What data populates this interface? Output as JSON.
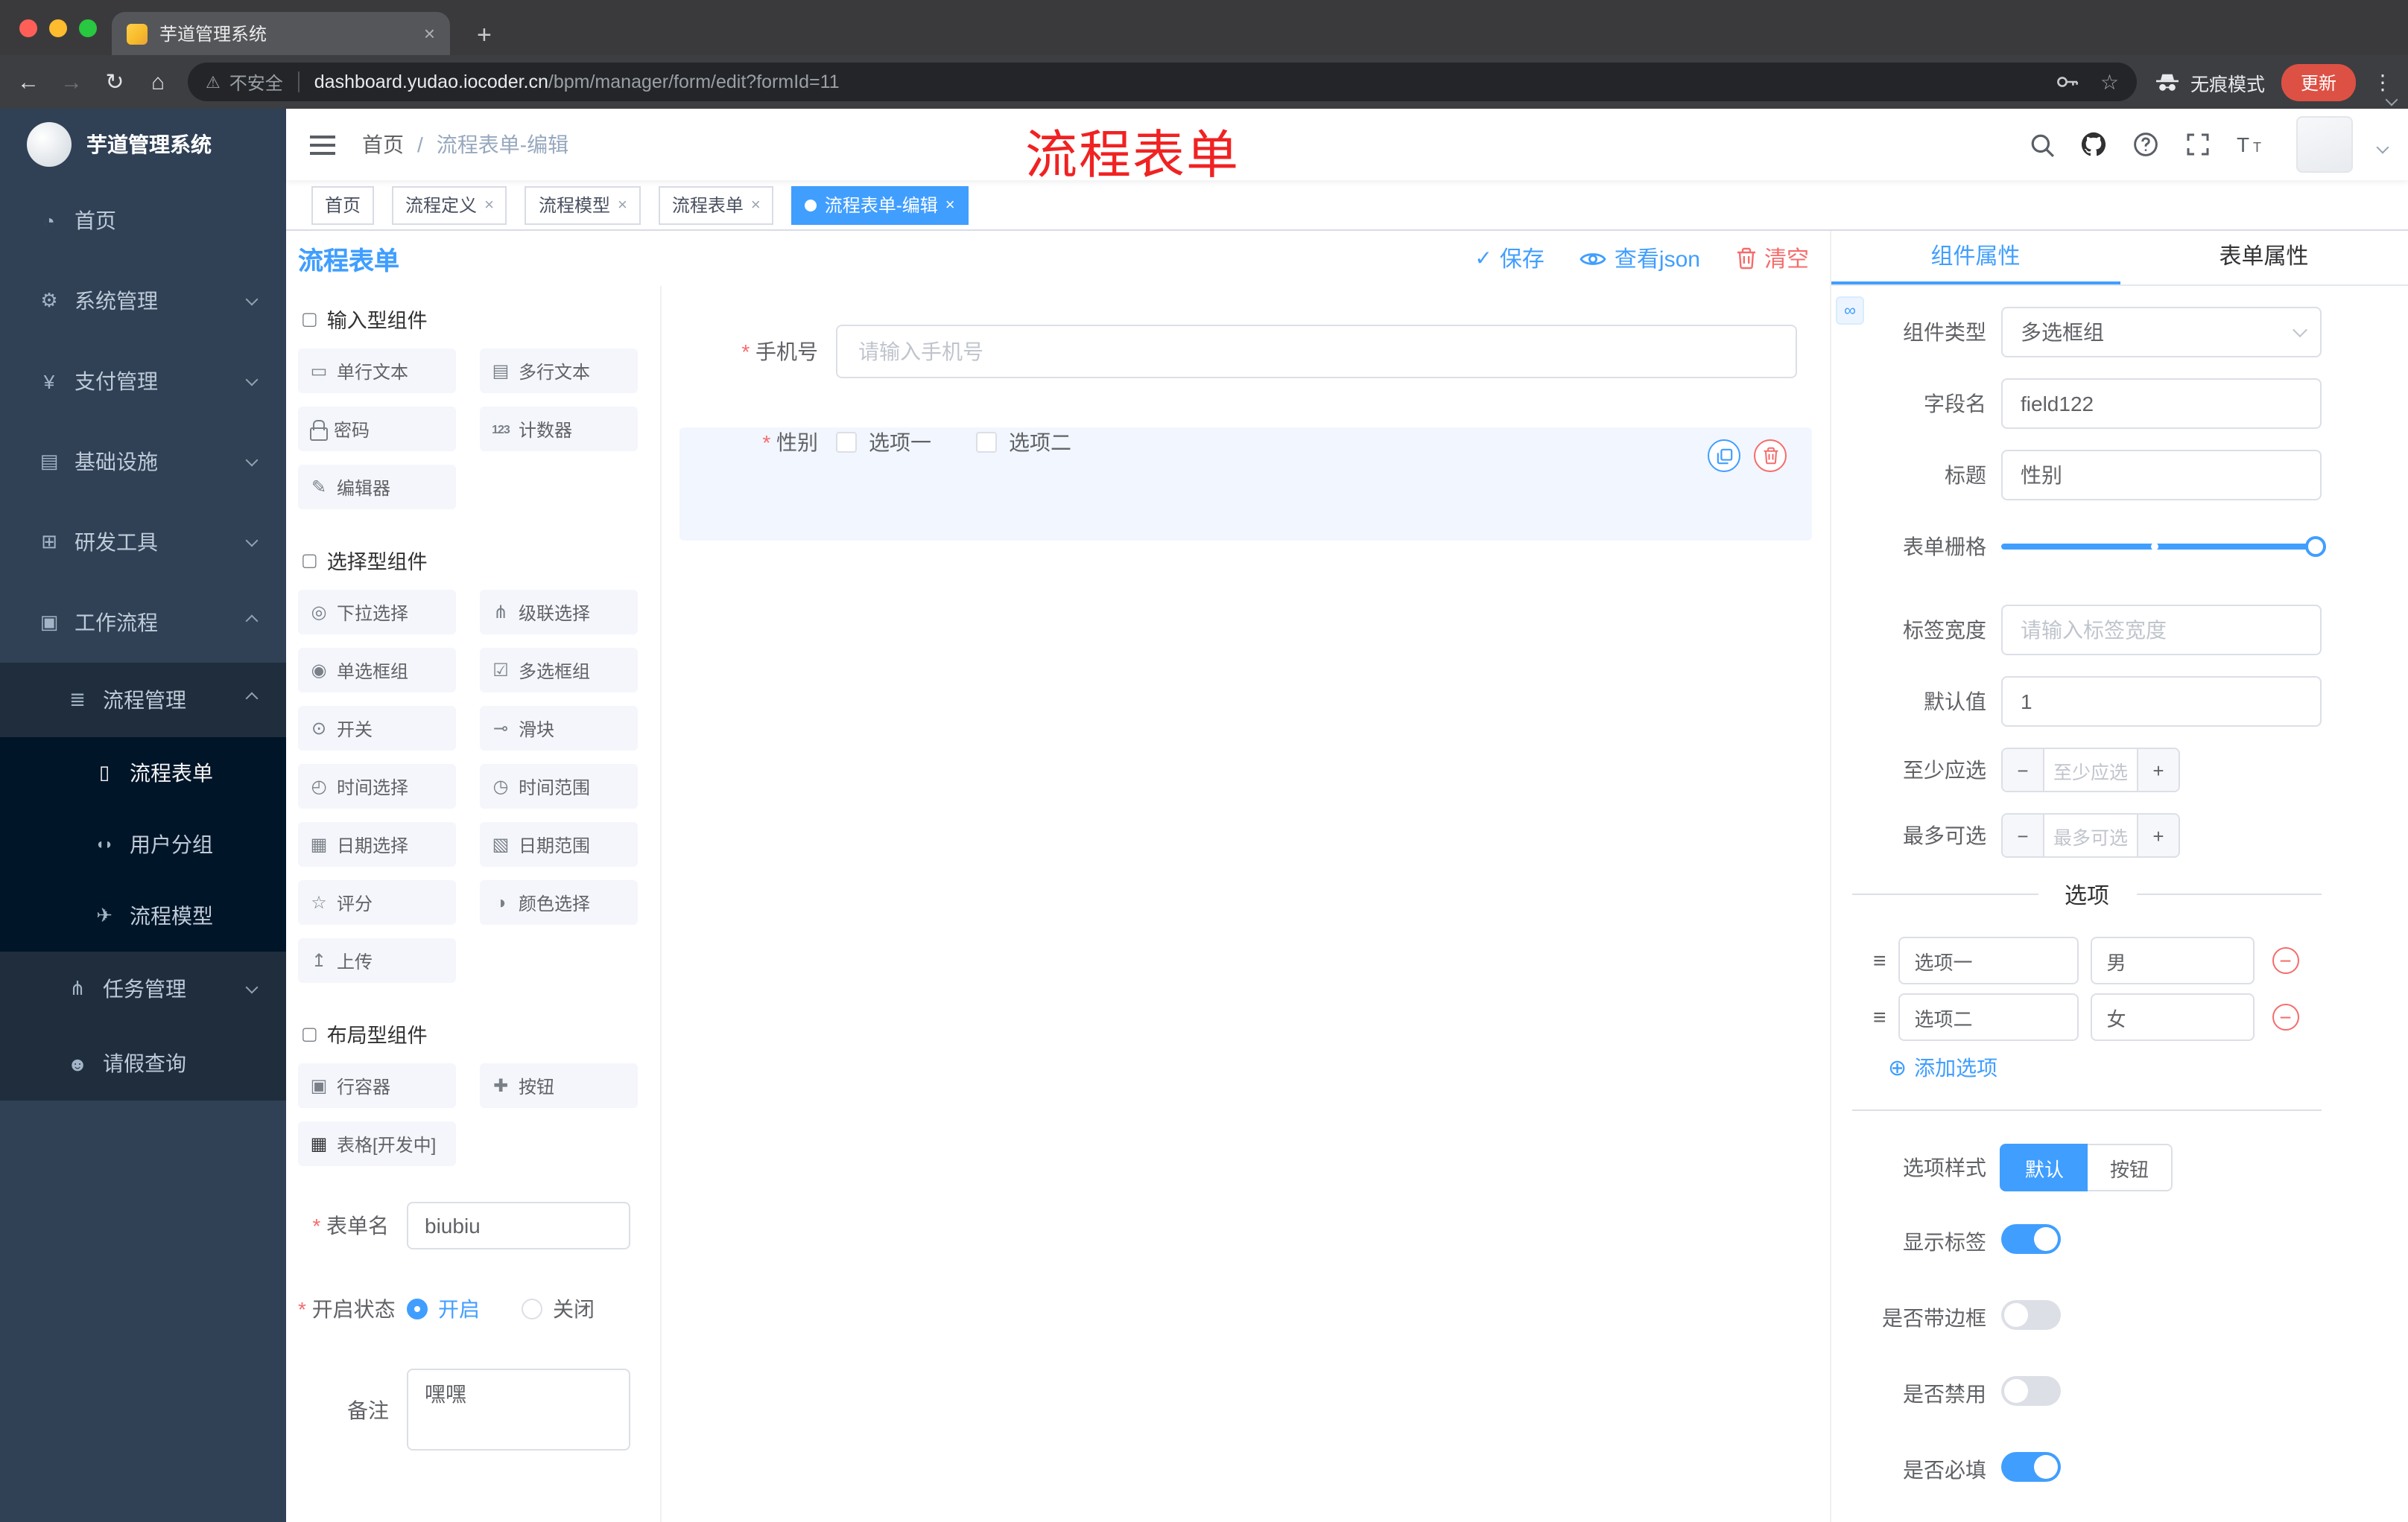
{
  "colors": {
    "primary": "#409eff",
    "danger": "#f56c6c",
    "annotation_red": "#f02222",
    "sidebar_bg": "#304156",
    "submenu_bg": "#1f2d3d",
    "submenu_deep_bg": "#001528",
    "active_tag_bg": "#409eff",
    "update_button_bg": "#dd5144"
  },
  "browser": {
    "tab_title": "芋道管理系统",
    "security_label": "不安全",
    "url_host": "dashboard.yudao.iocoder.cn",
    "url_path": "/bpm/manager/form/edit?formId=11",
    "incognito_label": "无痕模式",
    "update_label": "更新"
  },
  "sidebar": {
    "logo_title": "芋道管理系统",
    "items": [
      {
        "icon": "dashboard-icon",
        "label": "首页"
      },
      {
        "icon": "gear-icon",
        "label": "系统管理"
      },
      {
        "icon": "yen-icon",
        "label": "支付管理"
      },
      {
        "icon": "infrastructure-icon",
        "label": "基础设施"
      },
      {
        "icon": "dev-tools-icon",
        "label": "研发工具"
      },
      {
        "icon": "workflow-icon",
        "label": "工作流程"
      },
      {
        "icon": "process-management-icon",
        "label": "流程管理"
      },
      {
        "icon": "process-form-icon",
        "label": "流程表单"
      },
      {
        "icon": "user-group-icon",
        "label": "用户分组"
      },
      {
        "icon": "process-model-icon",
        "label": "流程模型"
      },
      {
        "icon": "task-management-icon",
        "label": "任务管理"
      },
      {
        "icon": "leave-query-icon",
        "label": "请假查询"
      }
    ]
  },
  "navbar": {
    "breadcrumb": {
      "home": "首页",
      "separator": "/",
      "current": "流程表单-编辑"
    },
    "annotation": "流程表单"
  },
  "tags": [
    {
      "label": "首页",
      "closable": false,
      "active": false
    },
    {
      "label": "流程定义",
      "closable": true,
      "active": false
    },
    {
      "label": "流程模型",
      "closable": true,
      "active": false
    },
    {
      "label": "流程表单",
      "closable": true,
      "active": false
    },
    {
      "label": "流程表单-编辑",
      "closable": true,
      "active": true
    }
  ],
  "designer": {
    "title": "流程表单",
    "save": "保存",
    "view_json": "查看json",
    "clear": "清空"
  },
  "palette": {
    "sections": [
      {
        "title": "输入型组件",
        "items": [
          {
            "icon": "text-field-icon",
            "label": "单行文本"
          },
          {
            "icon": "textarea-icon",
            "label": "多行文本"
          },
          {
            "icon": "lock-icon",
            "label": "密码"
          },
          {
            "icon": "counter-icon",
            "icon_text": "123",
            "label": "计数器"
          },
          {
            "icon": "editor-icon",
            "label": "编辑器"
          }
        ]
      },
      {
        "title": "选择型组件",
        "items": [
          {
            "icon": "select-icon",
            "label": "下拉选择"
          },
          {
            "icon": "cascader-icon",
            "label": "级联选择"
          },
          {
            "icon": "radio-group-icon",
            "label": "单选框组"
          },
          {
            "icon": "checkbox-group-icon",
            "label": "多选框组"
          },
          {
            "icon": "switch-icon",
            "label": "开关"
          },
          {
            "icon": "slider-icon",
            "label": "滑块"
          },
          {
            "icon": "time-picker-icon",
            "label": "时间选择"
          },
          {
            "icon": "time-range-icon",
            "label": "时间范围"
          },
          {
            "icon": "date-picker-icon",
            "label": "日期选择"
          },
          {
            "icon": "date-range-icon",
            "label": "日期范围"
          },
          {
            "icon": "rate-icon",
            "label": "评分"
          },
          {
            "icon": "color-picker-icon",
            "label": "颜色选择"
          },
          {
            "icon": "upload-icon",
            "label": "上传"
          }
        ]
      },
      {
        "title": "布局型组件",
        "items": [
          {
            "icon": "row-container-icon",
            "label": "行容器"
          },
          {
            "icon": "button-icon",
            "label": "按钮"
          },
          {
            "icon": "table-icon",
            "label": "表格[开发中]"
          }
        ]
      }
    ],
    "form": {
      "name_label": "表单名",
      "name_value": "biubiu",
      "status_label": "开启状态",
      "status_on": "开启",
      "status_off": "关闭",
      "remark_label": "备注",
      "remark_value": "嘿嘿"
    }
  },
  "canvas": {
    "phone": {
      "label": "手机号",
      "placeholder": "请输入手机号",
      "required": true
    },
    "gender": {
      "label": "性别",
      "option1": "选项一",
      "option2": "选项二",
      "required": true
    }
  },
  "props": {
    "tab_component": "组件属性",
    "tab_form": "表单属性",
    "component_type_label": "组件类型",
    "component_type_value": "多选框组",
    "field_name_label": "字段名",
    "field_name_value": "field122",
    "title_label": "标题",
    "title_value": "性别",
    "grid_label": "表单栅格",
    "label_width_label": "标签宽度",
    "label_width_placeholder": "请输入标签宽度",
    "default_label": "默认值",
    "default_value": "1",
    "min_label": "至少应选",
    "min_placeholder": "至少应选",
    "max_label": "最多可选",
    "max_placeholder": "最多可选",
    "options_divider": "选项",
    "options": [
      {
        "name": "选项一",
        "value": "男"
      },
      {
        "name": "选项二",
        "value": "女"
      }
    ],
    "add_option": "添加选项",
    "style_label": "选项样式",
    "style_default": "默认",
    "style_button": "按钮",
    "switch_show_label": "显示标签",
    "switch_border": "是否带边框",
    "switch_disabled": "是否禁用",
    "switch_required": "是否必填",
    "switch_states": {
      "show_label": true,
      "border": false,
      "disabled": false,
      "required": true
    }
  }
}
